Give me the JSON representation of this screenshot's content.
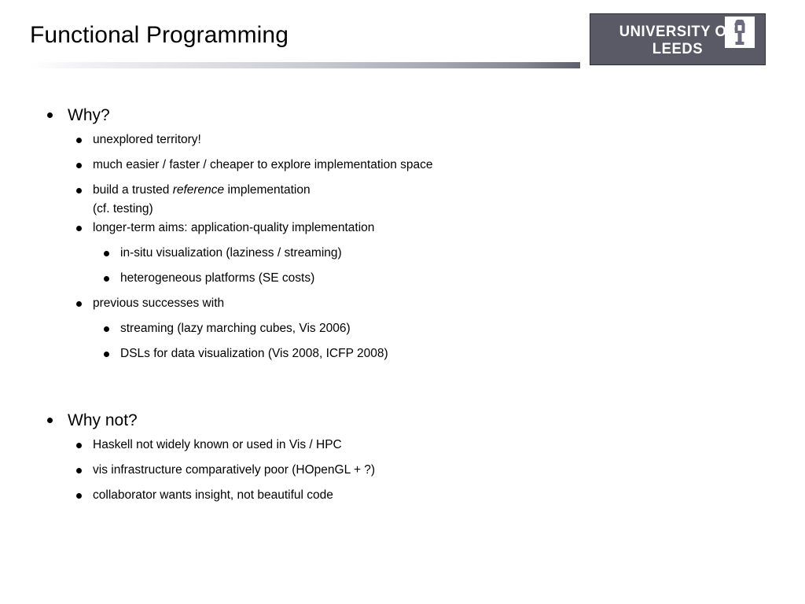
{
  "slide": {
    "title": "Functional Programming",
    "logo": {
      "name": "UNIVERSITY OF LEEDS",
      "crest_icon": "leeds-tower-crest-icon",
      "box_color": "#5a5a67",
      "text_color": "#ffffff"
    },
    "rule": {
      "gradient_from": "#ffffff",
      "gradient_to": "#5e5e6c"
    },
    "sections": [
      {
        "heading": "Why?",
        "items": [
          {
            "level": 2,
            "text": "unexplored territory!"
          },
          {
            "level": 2,
            "text": "much easier / faster / cheaper to explore implementation space"
          },
          {
            "level": 2,
            "text_before_italic": "build a trusted ",
            "italic_text": "reference",
            "text_after_italic": " implementation",
            "second_line": "(cf. testing)"
          },
          {
            "level": 2,
            "text": "longer-term aims: application-quality implementation"
          },
          {
            "level": 3,
            "text": "in-situ visualization (laziness / streaming)"
          },
          {
            "level": 3,
            "text": "heterogeneous platforms (SE costs)"
          },
          {
            "level": 2,
            "text": "previous successes with"
          },
          {
            "level": 3,
            "text": "streaming (lazy marching cubes, Vis 2006)"
          },
          {
            "level": 3,
            "text": "DSLs for data visualization (Vis 2008, ICFP 2008)"
          }
        ]
      },
      {
        "heading": "Why not?",
        "items": [
          {
            "level": 2,
            "text": "Haskell not widely known or used in Vis / HPC"
          },
          {
            "level": 2,
            "text": "vis infrastructure comparatively poor (HOpenGL + ?)"
          },
          {
            "level": 2,
            "text": "collaborator wants insight, not beautiful code"
          }
        ]
      }
    ]
  }
}
